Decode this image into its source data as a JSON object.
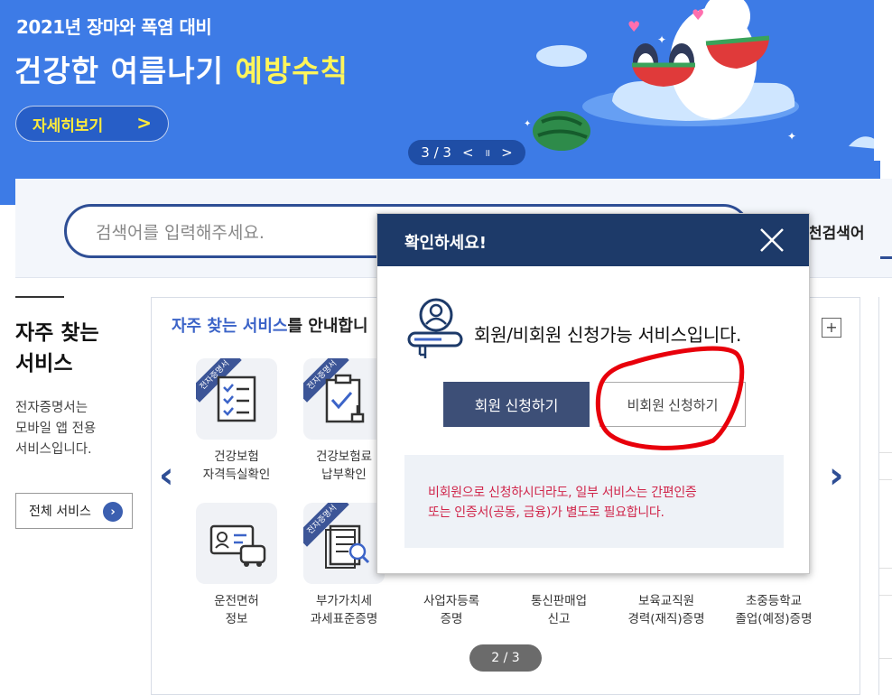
{
  "banner": {
    "subtitle": "2021년 장마와 폭염 대비",
    "title_main": "건강한 여름나기",
    "title_highlight": "예방수칙",
    "detail_button": "자세히보기",
    "detail_chevron": ">",
    "slide_counter": "3 / 3",
    "slide_prev": "<",
    "slide_pause": "॥",
    "slide_next": ">"
  },
  "search": {
    "placeholder": "검색어를 입력해주세요.",
    "realtime_label": "천검색어"
  },
  "side": {
    "title_line1": "자주 찾는",
    "title_line2": "서비스",
    "desc_line1": "전자증명서는",
    "desc_line2": "모바일 앱 전용",
    "desc_line3": "서비스입니다.",
    "all_services_button": "전체 서비스",
    "all_services_arrow": "›"
  },
  "services": {
    "heading_blue": "자주 찾는 서비스",
    "heading_rest": "를 안내합니",
    "plus": "+",
    "prev_arrow": "‹",
    "next_arrow": "›",
    "ribbon_label": "전자증명서",
    "page_indicator": "2 / 3",
    "items": [
      {
        "line1": "건강보험",
        "line2": "자격득실확인"
      },
      {
        "line1": "건강보험료",
        "line2": "납부확인"
      },
      {
        "line1": "운전면허",
        "line2": "정보"
      },
      {
        "line1": "부가가치세",
        "line2": "과세표준증명"
      },
      {
        "line1": "사업자등록",
        "line2": "증명"
      },
      {
        "line1": "통신판매업",
        "line2": "신고"
      },
      {
        "line1": "보육교직원",
        "line2": "경력(재직)증명"
      },
      {
        "line1": "초중등학교",
        "line2": "졸업(예정)증명"
      }
    ]
  },
  "modal": {
    "title": "확인하세요!",
    "message": "회원/비회원 신청가능 서비스입니다.",
    "member_button": "회원 신청하기",
    "guest_button": "비회원 신청하기",
    "note_line1": "비회원으로 신청하시더라도, 일부 서비스는 간편인증",
    "note_line2": "또는 인증서(공동, 금융)가 별도로 필요합니다."
  },
  "colors": {
    "banner_bg": "#3d7be6",
    "navy": "#1d3a69",
    "accent_blue": "#3c64c8",
    "warning_red": "#d0264b",
    "annotation_red": "#e8000b"
  }
}
